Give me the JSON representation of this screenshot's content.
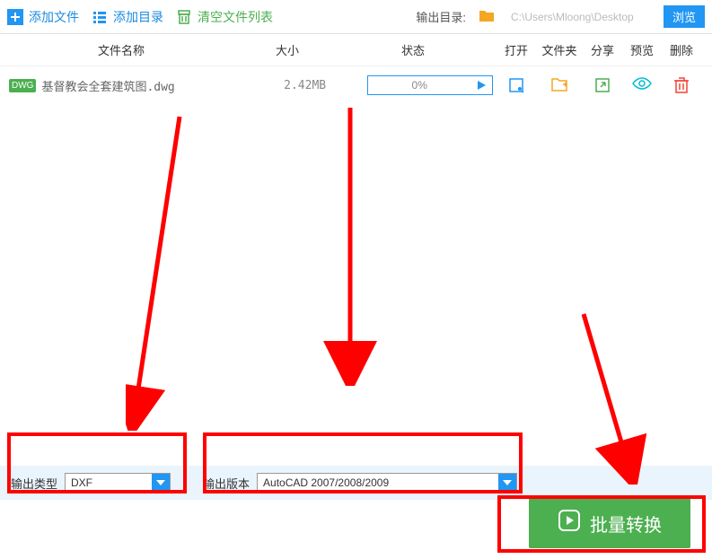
{
  "toolbar": {
    "add_file": "添加文件",
    "add_folder": "添加目录",
    "clear_list": "清空文件列表",
    "output_dir_label": "输出目录:",
    "output_path": "C:\\Users\\Mloong\\Desktop",
    "browse": "浏览"
  },
  "headers": {
    "name": "文件名称",
    "size": "大小",
    "status": "状态",
    "open": "打开",
    "folder": "文件夹",
    "share": "分享",
    "preview": "预览",
    "delete": "删除"
  },
  "file": {
    "badge": "DWG",
    "name": "基督教会全套建筑图.dwg",
    "size": "2.42MB",
    "progress": "0%"
  },
  "bottom": {
    "output_type_label": "输出类型",
    "output_type_value": "DXF",
    "output_version_label": "输出版本",
    "output_version_value": "AutoCAD 2007/2008/2009"
  },
  "convert_button": "批量转换"
}
